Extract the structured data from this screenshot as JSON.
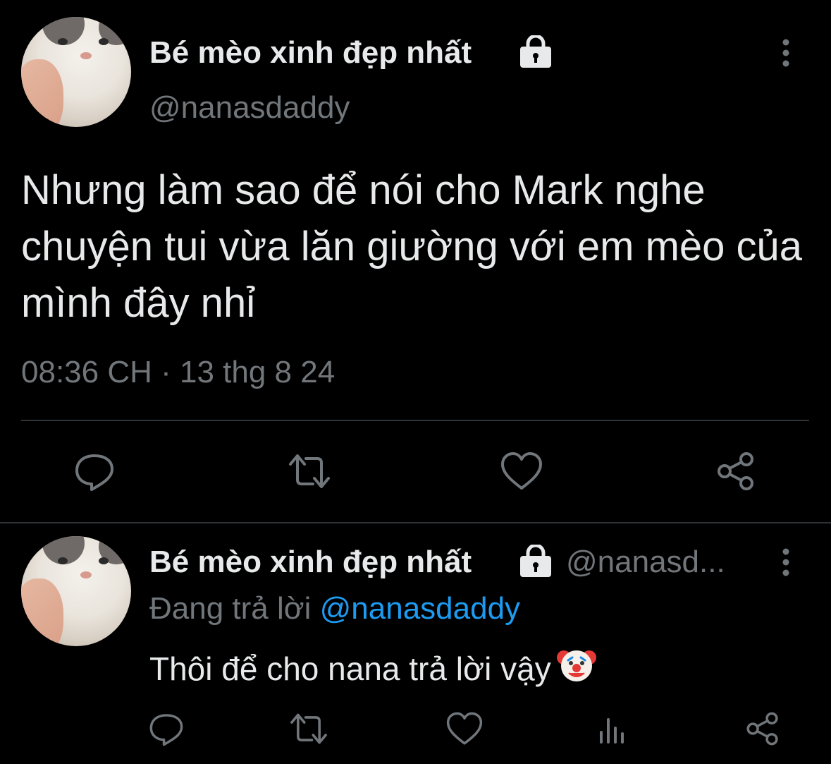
{
  "tweet1": {
    "display_name": "Bé mèo xinh đẹp nhất",
    "handle": "@nanasdaddy",
    "text": "Nhưng làm sao để nói cho Mark nghe chuyện tui vừa lăn giường với em mèo của mình đây nhỉ",
    "timestamp": "08:36 CH · 13 thg 8 24",
    "icons": {
      "protected": "lock-icon",
      "menu": "more-vertical-icon",
      "reply": "reply-icon",
      "retweet": "retweet-icon",
      "like": "heart-icon",
      "share": "share-icon"
    }
  },
  "tweet2": {
    "display_name": "Bé mèo xinh đẹp nhất",
    "handle": "@nanasd...",
    "replying_prefix": "Đang trả lời ",
    "replying_to": "@nanasdaddy",
    "text": "Thôi để cho nana trả lời vậy",
    "emoji": "clown-face",
    "icons": {
      "protected": "lock-icon",
      "menu": "more-vertical-icon",
      "reply": "reply-icon",
      "retweet": "retweet-icon",
      "like": "heart-icon",
      "views": "views-icon",
      "share": "share-icon"
    }
  },
  "colors": {
    "background": "#000000",
    "primary_text": "#e7e9ea",
    "secondary_text": "#71767b",
    "link": "#1d9bf0",
    "divider": "#2f3336"
  }
}
